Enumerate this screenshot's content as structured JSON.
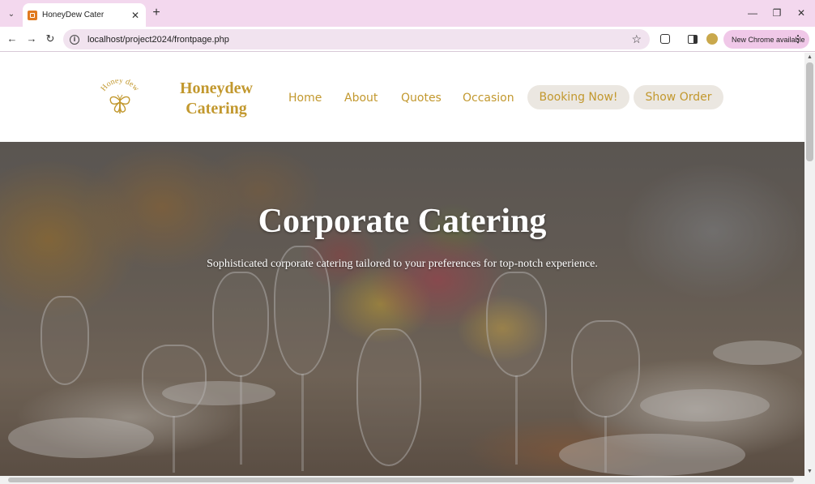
{
  "browser": {
    "tab": {
      "title": "HoneyDew Cater",
      "close": "✕"
    },
    "new_tab": "+",
    "tab_search": "⌄",
    "window": {
      "minimize": "—",
      "maximize": "❐",
      "close": "✕"
    },
    "nav": {
      "back": "←",
      "forward": "→",
      "reload": "↻"
    },
    "url": "localhost/project2024/frontpage.php",
    "update_button": "New Chrome available",
    "menu": "⋮"
  },
  "site": {
    "logo_text": "Honey dew",
    "brand": {
      "line1": "Honeydew",
      "line2": "Catering"
    },
    "nav": {
      "home": "Home",
      "about": "About",
      "quotes": "Quotes",
      "occasion": "Occasion",
      "booking": "Booking Now!",
      "show_order": "Show Order"
    },
    "hero": {
      "title": "Corporate Catering",
      "subtitle": "Sophisticated corporate catering tailored to your preferences for top-notch experience."
    },
    "colors": {
      "accent": "#c2982e",
      "pill_bg": "#ebe7e1"
    }
  }
}
